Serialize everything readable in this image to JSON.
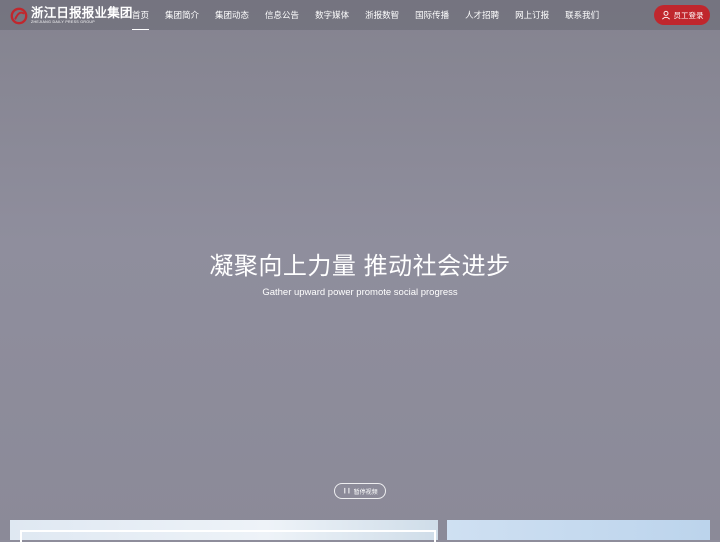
{
  "brand": {
    "name_cn": "浙江日报报业集团",
    "name_en": "ZHEJIANG DAILY PRESS GROUP",
    "color": "#c0272d"
  },
  "nav": {
    "items": [
      {
        "label": "首页",
        "active": true
      },
      {
        "label": "集团简介",
        "active": false
      },
      {
        "label": "集团动态",
        "active": false
      },
      {
        "label": "信息公告",
        "active": false
      },
      {
        "label": "数字媒体",
        "active": false
      },
      {
        "label": "浙报数智",
        "active": false
      },
      {
        "label": "国际传播",
        "active": false
      },
      {
        "label": "人才招聘",
        "active": false
      },
      {
        "label": "网上订报",
        "active": false
      },
      {
        "label": "联系我们",
        "active": false
      }
    ]
  },
  "login": {
    "label": "员工登录",
    "icon": "user-icon"
  },
  "hero": {
    "title": "凝聚向上力量 推动社会进步",
    "subtitle": "Gather upward power promote social progress"
  },
  "video": {
    "pause_label": "暂停视频",
    "icon": "pause-icon"
  }
}
